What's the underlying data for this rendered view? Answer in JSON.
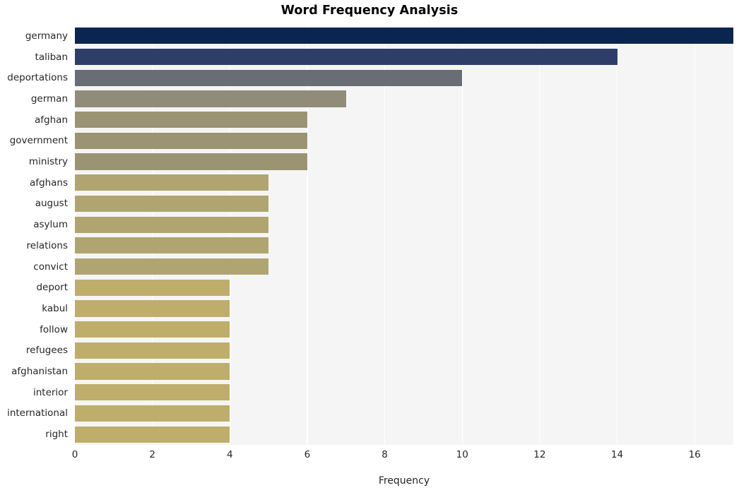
{
  "chart_data": {
    "type": "bar",
    "orientation": "horizontal",
    "title": "Word Frequency Analysis",
    "xlabel": "Frequency",
    "ylabel": "",
    "xlim": [
      0,
      17
    ],
    "ylim": null,
    "grid": true,
    "legend": null,
    "xticks": [
      0,
      2,
      4,
      6,
      8,
      10,
      12,
      14,
      16
    ],
    "xtick_labels": [
      "0",
      "2",
      "4",
      "6",
      "8",
      "10",
      "12",
      "14",
      "16"
    ],
    "categories": [
      "germany",
      "taliban",
      "deportations",
      "german",
      "afghan",
      "government",
      "ministry",
      "afghans",
      "august",
      "asylum",
      "relations",
      "convict",
      "deport",
      "kabul",
      "follow",
      "refugees",
      "afghanistan",
      "interior",
      "international",
      "right"
    ],
    "values": [
      17,
      14,
      10,
      7,
      6,
      6,
      6,
      5,
      5,
      5,
      5,
      5,
      4,
      4,
      4,
      4,
      4,
      4,
      4,
      4
    ],
    "bar_colors": [
      "#0a2550",
      "#2e3e68",
      "#6a6c76",
      "#918c79",
      "#9a9472",
      "#9a9472",
      "#9a9472",
      "#b0a571",
      "#b0a571",
      "#b0a571",
      "#b0a571",
      "#b0a571",
      "#bfae6b",
      "#bfae6b",
      "#bfae6b",
      "#bfae6b",
      "#bfae6b",
      "#bfae6b",
      "#bfae6b",
      "#bfae6b"
    ],
    "plot_background": "#f5f5f5",
    "figure_background": "#ffffff",
    "gridline_color": "#ffffff"
  }
}
